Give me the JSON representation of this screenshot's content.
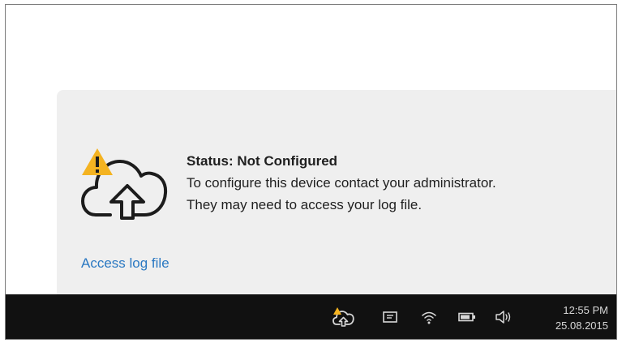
{
  "notification": {
    "status_title": "Status: Not Configured",
    "message_line1": "To configure this device contact your administrator.",
    "message_line2": "They may need to access your log file.",
    "access_link_label": "Access log file",
    "icon": "cloud-upload-warning-icon",
    "warning_color": "#f4b321",
    "link_color": "#2a78c2"
  },
  "taskbar": {
    "tray_icons": [
      "cloud-upload-warning-icon",
      "action-center-icon",
      "wifi-icon",
      "battery-icon",
      "volume-icon"
    ],
    "clock": {
      "time": "12:55 PM",
      "date": "25.08.2015"
    }
  }
}
